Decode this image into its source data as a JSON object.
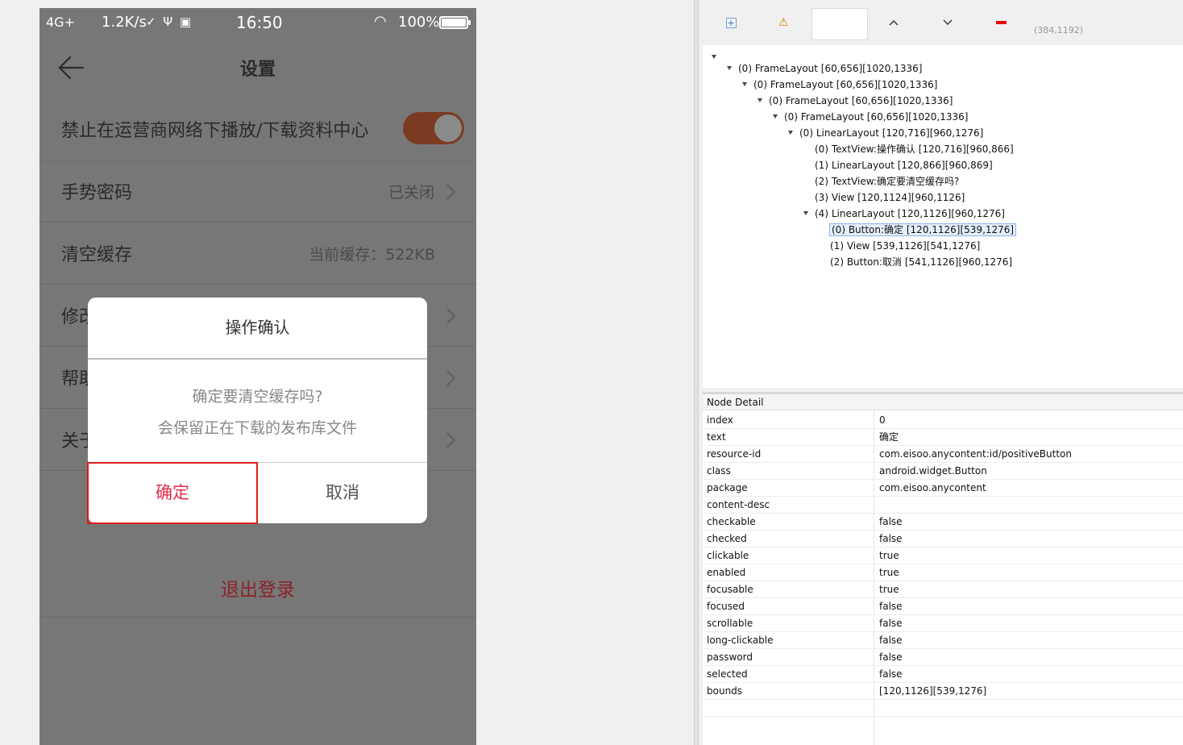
{
  "phone": {
    "status_bar": {
      "network": "4G+",
      "speed": "1.2K/s",
      "misc_icons": "✓ Ψ ▣",
      "time": "16:50",
      "wifi_glyph": "◠",
      "battery_pct": "100%"
    },
    "nav": {
      "title": "设置"
    },
    "settings": {
      "items": [
        {
          "label": "禁止在运营商网络下播放/下载资料中心",
          "value": "",
          "toggle_on": true
        },
        {
          "label": "手势密码",
          "value": "已关闭"
        },
        {
          "label": "清空缓存",
          "value": "当前缓存：522KB"
        },
        {
          "label": "修改"
        },
        {
          "label": "帮助"
        },
        {
          "label": "关于"
        }
      ]
    },
    "logout_label": "退出登录",
    "dialog": {
      "title": "操作确认",
      "message_line1": "确定要清空缓存吗?",
      "message_line2": "会保留正在下载的发布库文件",
      "confirm_label": "确定",
      "cancel_label": "取消"
    }
  },
  "inspector": {
    "coords": "(384,1192)",
    "tree": [
      {
        "text": "(0) FrameLayout [60,656][1020,1336]",
        "expanded": true
      },
      {
        "text": "(0) FrameLayout [60,656][1020,1336]",
        "expanded": true
      },
      {
        "text": "(0) FrameLayout [60,656][1020,1336]",
        "expanded": true
      },
      {
        "text": "(0) FrameLayout [60,656][1020,1336]",
        "expanded": true
      },
      {
        "text": "(0) LinearLayout [120,716][960,1276]",
        "expanded": true
      },
      {
        "text": "(0) TextView:操作确认 [120,716][960,866]",
        "expanded": false
      },
      {
        "text": "(1) LinearLayout [120,866][960,869]",
        "expanded": false
      },
      {
        "text": "(2) TextView:确定要清空缓存吗?",
        "expanded": false
      },
      {
        "text": "(3) View [120,1124][960,1126]",
        "expanded": false
      },
      {
        "text": "(4) LinearLayout [120,1126][960,1276]",
        "expanded": true
      },
      {
        "text": "(0) Button:确定 [120,1126][539,1276]",
        "expanded": false,
        "selected": true
      },
      {
        "text": "(1) View [539,1126][541,1276]",
        "expanded": false
      },
      {
        "text": "(2) Button:取消 [541,1126][960,1276]",
        "expanded": false
      }
    ],
    "detail_header": "Node Detail",
    "detail": [
      {
        "key": "index",
        "value": "0"
      },
      {
        "key": "text",
        "value": "确定"
      },
      {
        "key": "resource-id",
        "value": "com.eisoo.anycontent:id/positiveButton"
      },
      {
        "key": "class",
        "value": "android.widget.Button"
      },
      {
        "key": "package",
        "value": "com.eisoo.anycontent"
      },
      {
        "key": "content-desc",
        "value": ""
      },
      {
        "key": "checkable",
        "value": "false"
      },
      {
        "key": "checked",
        "value": "false"
      },
      {
        "key": "clickable",
        "value": "true"
      },
      {
        "key": "enabled",
        "value": "true"
      },
      {
        "key": "focusable",
        "value": "true"
      },
      {
        "key": "focused",
        "value": "false"
      },
      {
        "key": "scrollable",
        "value": "false"
      },
      {
        "key": "long-clickable",
        "value": "false"
      },
      {
        "key": "password",
        "value": "false"
      },
      {
        "key": "selected",
        "value": "false"
      },
      {
        "key": "bounds",
        "value": "[120,1126][539,1276]"
      },
      {
        "key": "",
        "value": ""
      }
    ]
  }
}
